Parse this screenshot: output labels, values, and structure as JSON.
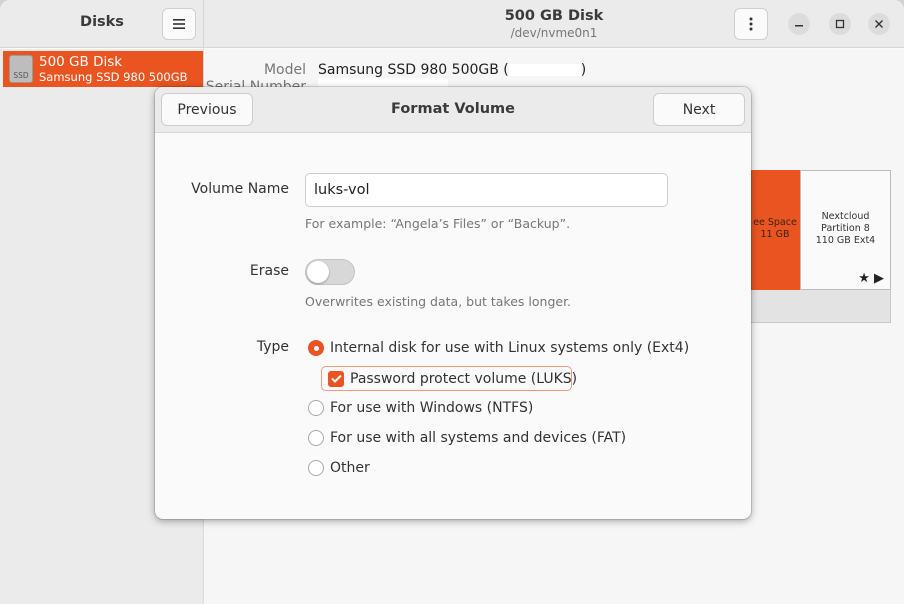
{
  "sidebar": {
    "title": "Disks",
    "disks": [
      {
        "name": "500 GB Disk",
        "model": "Samsung SSD 980 500GB",
        "icon_label": "SSD"
      }
    ]
  },
  "header": {
    "title": "500 GB Disk",
    "subtitle": "/dev/nvme0n1"
  },
  "disk_info": {
    "model_label": "Model",
    "model_value_prefix": "Samsung SSD 980 500GB (",
    "model_value_suffix": ")",
    "serial_label": "Serial Number"
  },
  "volumes": {
    "free_space": {
      "line1": "ee Space",
      "line2": "11 GB"
    },
    "partition": {
      "line1": "Nextcloud",
      "line2": "Partition 8",
      "line3": "110 GB Ext4"
    }
  },
  "dialog": {
    "title": "Format Volume",
    "previous_label": "Previous",
    "next_label": "Next",
    "volume_name_label": "Volume Name",
    "volume_name_value": "luks-vol",
    "volume_name_hint": "For example: “Angela’s Files” or “Backup”.",
    "erase_label": "Erase",
    "erase_enabled": false,
    "erase_hint": "Overwrites existing data, but takes longer.",
    "type_label": "Type",
    "type_options": [
      "Internal disk for use with Linux systems only (Ext4)",
      "For use with Windows (NTFS)",
      "For use with all systems and devices (FAT)",
      "Other"
    ],
    "selected_type": "Internal disk for use with Linux systems only (Ext4)",
    "luks_label": "Password protect volume (LUKS)",
    "luks_checked": true
  },
  "colors": {
    "accent": "#e95420",
    "focus_ring": "#f09b7a"
  }
}
